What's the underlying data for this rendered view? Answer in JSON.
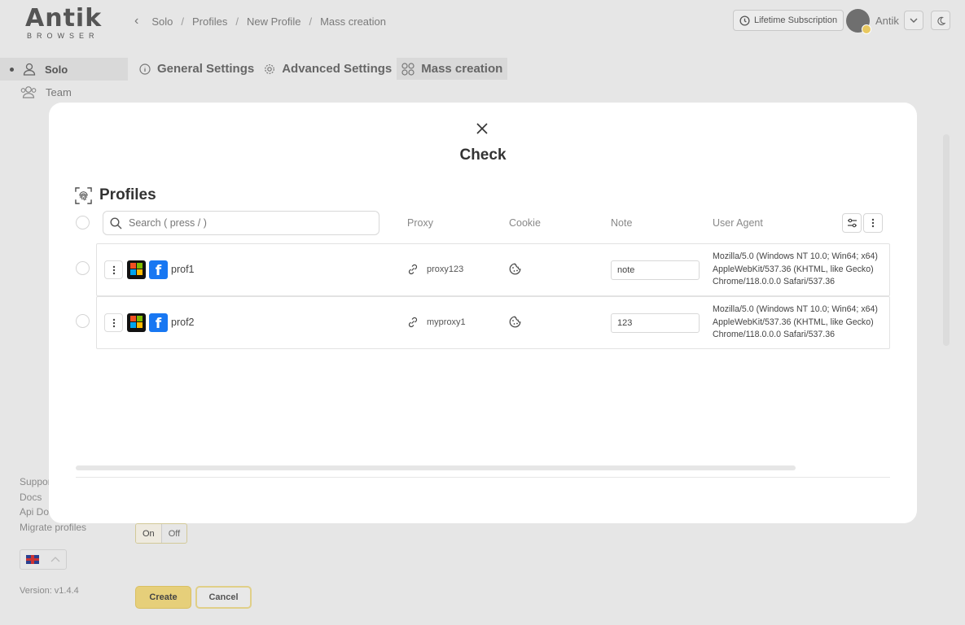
{
  "app": {
    "logo_word": "Antik",
    "logo_sub": "BROWSER"
  },
  "breadcrumb": [
    "Solo",
    "Profiles",
    "New Profile",
    "Mass creation"
  ],
  "header": {
    "subscription": "Lifetime Subscription",
    "user_name": "Antik"
  },
  "sidebar": {
    "items": [
      {
        "label": "Solo"
      },
      {
        "label": "Team"
      }
    ],
    "links": [
      "Support",
      "Docs",
      "Api Docs",
      "Migrate profiles"
    ],
    "version": "Version: v1.4.4"
  },
  "tabs": [
    {
      "label": "General Settings"
    },
    {
      "label": "Advanced Settings"
    },
    {
      "label": "Mass creation"
    }
  ],
  "toggle": {
    "on": "On",
    "off": "Off"
  },
  "form_buttons": {
    "create": "Create",
    "cancel": "Cancel"
  },
  "modal": {
    "title": "Check",
    "section_title": "Profiles",
    "search_placeholder": "Search ( press / )",
    "columns": {
      "proxy": "Proxy",
      "cookie": "Cookie",
      "note": "Note",
      "user_agent": "User Agent"
    },
    "rows": [
      {
        "name": "prof1",
        "proxy": "proxy123",
        "note": "note",
        "ua": [
          "Mozilla/5.0 (Windows NT 10.0; Win64; x64)",
          "AppleWebKit/537.36 (KHTML, like Gecko)",
          "Chrome/118.0.0.0 Safari/537.36"
        ]
      },
      {
        "name": "prof2",
        "proxy": "myproxy1",
        "note": "123",
        "ua": [
          "Mozilla/5.0 (Windows NT 10.0; Win64; x64)",
          "AppleWebKit/537.36 (KHTML, like Gecko)",
          "Chrome/118.0.0.0 Safari/537.36"
        ]
      }
    ]
  },
  "colors": {
    "accent": "#e6cf7a",
    "facebook": "#1877f2",
    "overlay_bg": "#e6e6e6"
  }
}
